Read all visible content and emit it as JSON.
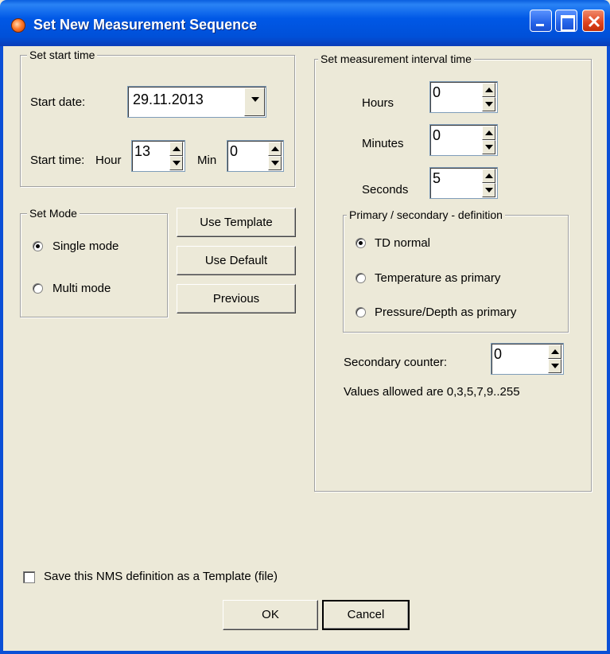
{
  "window": {
    "title": "Set New Measurement Sequence"
  },
  "start_time": {
    "group_label": "Set start time",
    "date_label": "Start date:",
    "date_value": "29.11.2013",
    "time_label": "Start time:",
    "hour_label": "Hour",
    "hour_value": "13",
    "min_label": "Min",
    "min_value": "0"
  },
  "mode": {
    "group_label": "Set Mode",
    "single_label": "Single mode",
    "multi_label": "Multi mode",
    "selected": "single"
  },
  "template_buttons": {
    "use_template": "Use Template",
    "use_default": "Use Default",
    "previous": "Previous"
  },
  "interval": {
    "group_label": "Set measurement interval time",
    "hours_label": "Hours",
    "hours_value": "0",
    "minutes_label": "Minutes",
    "minutes_value": "0",
    "seconds_label": "Seconds",
    "seconds_value": "5"
  },
  "primary": {
    "group_label": "Primary / secondary - definition",
    "options": [
      "TD normal",
      "Temperature as primary",
      "Pressure/Depth as primary"
    ],
    "selected": "TD normal"
  },
  "secondary": {
    "label": "Secondary counter:",
    "value": "0",
    "hint": "Values allowed are 0,3,5,7,9..255"
  },
  "save_template": {
    "label": "Save this NMS definition as a Template (file)",
    "checked": false
  },
  "footer": {
    "ok": "OK",
    "cancel": "Cancel"
  },
  "colors": {
    "titlebar": "#0058e6",
    "dialog_bg": "#ece9d8"
  }
}
